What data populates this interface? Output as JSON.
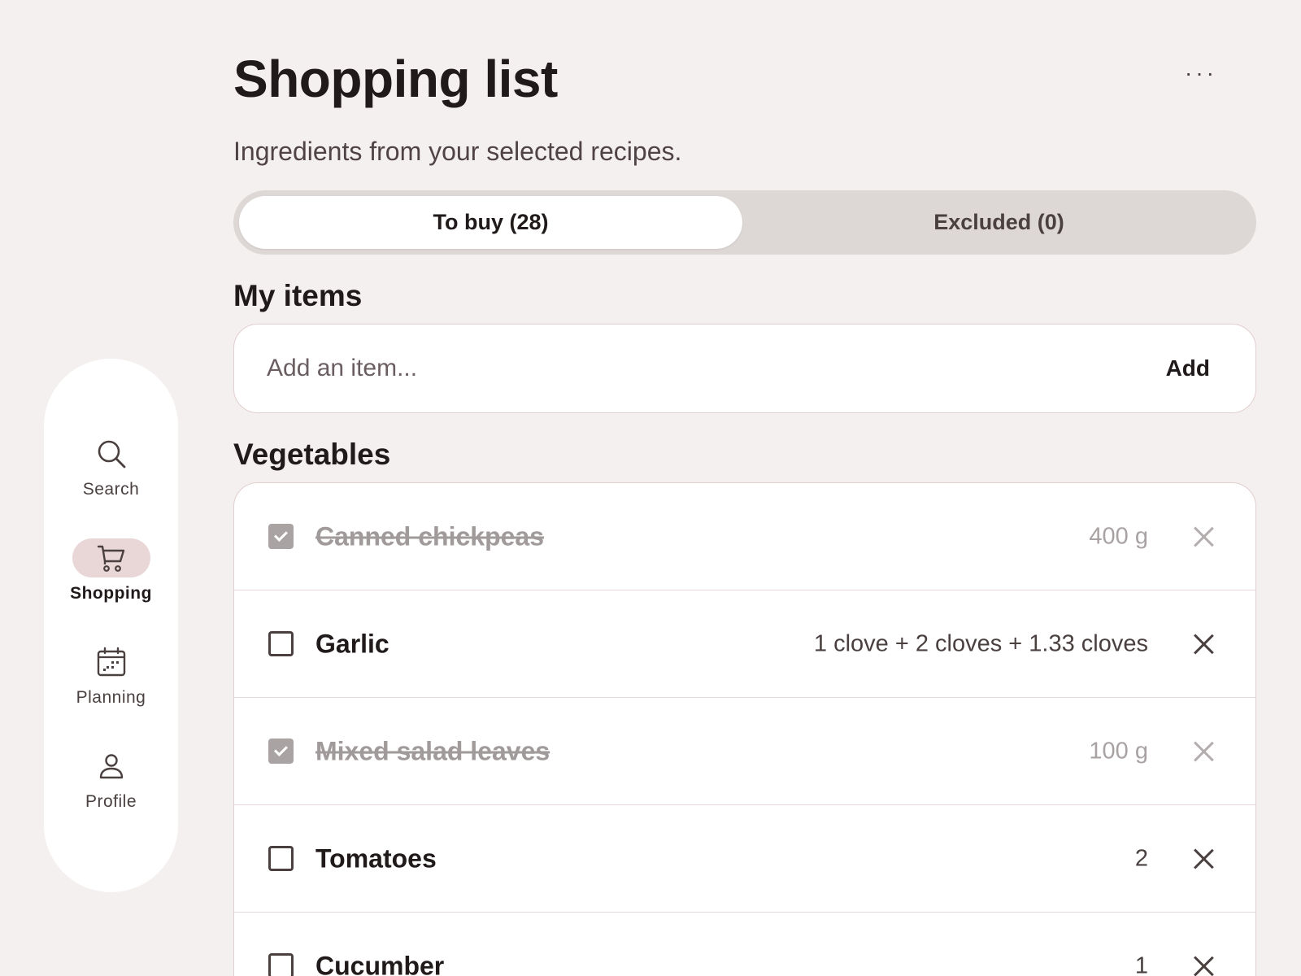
{
  "header": {
    "title": "Shopping list",
    "subtitle": "Ingredients from your selected recipes.",
    "more_label": "···"
  },
  "tabs": [
    {
      "label": "To buy (28)",
      "active": true
    },
    {
      "label": "Excluded (0)",
      "active": false
    }
  ],
  "my_items": {
    "heading": "My items",
    "placeholder": "Add an item...",
    "add_label": "Add"
  },
  "vegetables": {
    "heading": "Vegetables",
    "items": [
      {
        "name": "Canned chickpeas",
        "qty": "400 g",
        "checked": true
      },
      {
        "name": "Garlic",
        "qty": "1 clove + 2 cloves + 1.33 cloves",
        "checked": false
      },
      {
        "name": "Mixed salad leaves",
        "qty": "100 g",
        "checked": true
      },
      {
        "name": "Tomatoes",
        "qty": "2",
        "checked": false
      },
      {
        "name": "Cucumber",
        "qty": "1",
        "checked": false
      }
    ]
  },
  "nav": {
    "items": [
      {
        "label": "Search",
        "icon": "search-icon",
        "active": false
      },
      {
        "label": "Shopping",
        "icon": "cart-icon",
        "active": true
      },
      {
        "label": "Planning",
        "icon": "calendar-icon",
        "active": false
      },
      {
        "label": "Profile",
        "icon": "person-icon",
        "active": false
      }
    ]
  },
  "colors": {
    "background": "#f4f0ef",
    "active_nav_pill": "#e9d6d7",
    "tab_track": "#ddd7d6",
    "border": "#e2cfd0"
  }
}
